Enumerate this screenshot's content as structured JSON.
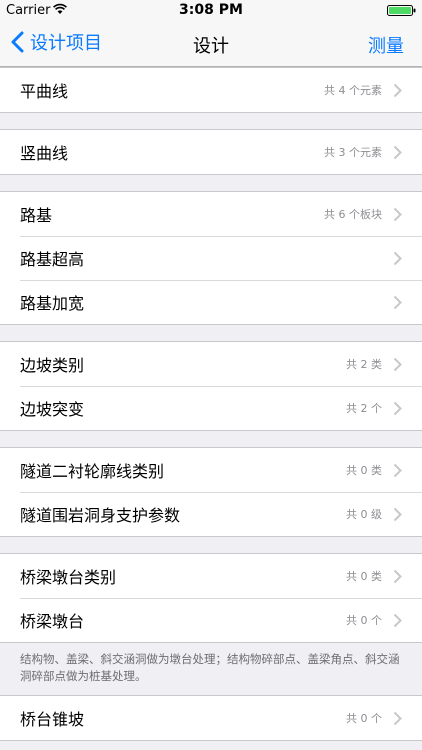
{
  "status": {
    "carrier": "Carrier",
    "time": "3:08 PM"
  },
  "nav": {
    "back_label": "设计项目",
    "title": "设计",
    "right_label": "测量"
  },
  "sections": [
    {
      "rows": [
        {
          "label": "平曲线",
          "detail": "共 4 个元素"
        }
      ]
    },
    {
      "rows": [
        {
          "label": "竖曲线",
          "detail": "共 3 个元素"
        }
      ]
    },
    {
      "rows": [
        {
          "label": "路基",
          "detail": "共 6 个板块"
        },
        {
          "label": "路基超高",
          "detail": ""
        },
        {
          "label": "路基加宽",
          "detail": ""
        }
      ]
    },
    {
      "rows": [
        {
          "label": "边坡类别",
          "detail": "共 2 类"
        },
        {
          "label": "边坡突变",
          "detail": "共 2 个"
        }
      ]
    },
    {
      "rows": [
        {
          "label": "隧道二衬轮廓线类别",
          "detail": "共 0 类"
        },
        {
          "label": "隧道围岩洞身支护参数",
          "detail": "共 0 级"
        }
      ]
    },
    {
      "rows": [
        {
          "label": "桥梁墩台类别",
          "detail": "共 0 类"
        },
        {
          "label": "桥梁墩台",
          "detail": "共 0 个"
        }
      ],
      "footer": "结构物、盖梁、斜交涵洞做为墩台处理；结构物碎部点、盖梁角点、斜交涵洞碎部点做为桩基处理。"
    },
    {
      "rows": [
        {
          "label": "桥台锥坡",
          "detail": "共 0 个"
        }
      ]
    }
  ]
}
